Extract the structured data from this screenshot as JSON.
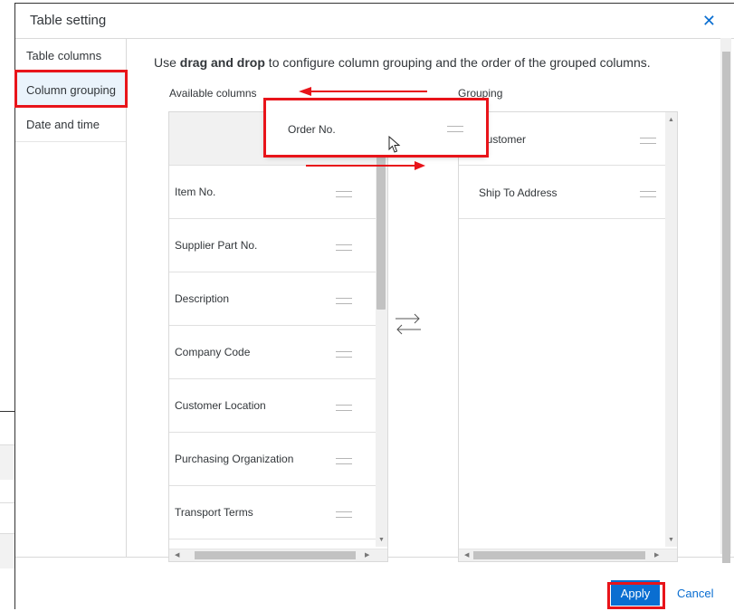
{
  "dialog": {
    "title": "Table setting",
    "close_glyph": "✕"
  },
  "nav": {
    "items": [
      {
        "label": "Table columns"
      },
      {
        "label": "Column grouping"
      },
      {
        "label": "Date and time"
      }
    ]
  },
  "content": {
    "instruction_prefix": "Use ",
    "instruction_bold": "drag and drop",
    "instruction_suffix": " to configure column grouping and the order of the grouped columns.",
    "available_label": "Available columns",
    "grouping_label": "Grouping"
  },
  "available_columns": [
    {
      "label": "Item No."
    },
    {
      "label": "Supplier Part No."
    },
    {
      "label": "Description"
    },
    {
      "label": "Company Code"
    },
    {
      "label": "Customer Location"
    },
    {
      "label": "Purchasing Organization"
    },
    {
      "label": "Transport Terms"
    }
  ],
  "grouping_columns": [
    {
      "label": "Customer"
    },
    {
      "label": "Ship To Address"
    }
  ],
  "dragging_item": {
    "label": "Order No."
  },
  "footer": {
    "apply_label": "Apply",
    "cancel_label": "Cancel"
  },
  "colors": {
    "accent": "#0a6ed1",
    "highlight": "#e8141a"
  },
  "icons": {
    "close": "close-icon",
    "swap": "swap-arrows-icon",
    "grip": "drag-handle-icon",
    "cursor": "mouse-cursor-icon"
  }
}
